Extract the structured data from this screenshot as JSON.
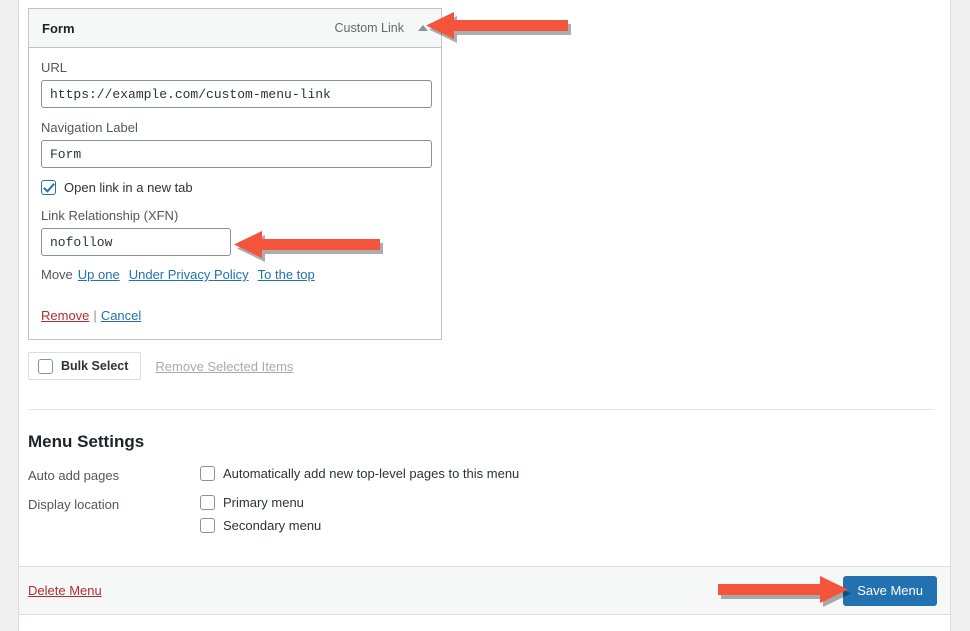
{
  "menu_item": {
    "title": "Form",
    "type_label": "Custom Link",
    "collapse_icon": "caret-up-icon",
    "fields": {
      "url_label": "URL",
      "url_value": "https://example.com/custom-menu-link",
      "url_placeholder": "https://",
      "nav_label_label": "Navigation Label",
      "nav_label_value": "Form",
      "nav_label_placeholder": "Navigation Label",
      "new_tab_label": "Open link in a new tab",
      "new_tab_checked": true,
      "xfn_label": "Link Relationship (XFN)",
      "xfn_value": "nofollow",
      "xfn_placeholder": "Link Relationship (XFN)"
    },
    "move": {
      "word": "Move",
      "links": [
        "Up one",
        "Under Privacy Policy",
        "To the top"
      ]
    },
    "actions": {
      "remove": "Remove",
      "separator": "|",
      "cancel": "Cancel"
    }
  },
  "bulk": {
    "select_label": "Bulk Select",
    "select_checked": false,
    "remove_selected_label": "Remove Selected Items",
    "remove_selected_disabled": true
  },
  "menu_settings": {
    "title": "Menu Settings",
    "auto_add": {
      "label": "Auto add pages",
      "option_label": "Automatically add new top-level pages to this menu",
      "checked": false
    },
    "display_location": {
      "label": "Display location",
      "options": [
        {
          "label": "Primary menu",
          "checked": false
        },
        {
          "label": "Secondary menu",
          "checked": false
        }
      ]
    }
  },
  "bottom_bar": {
    "delete_menu_label": "Delete Menu",
    "save_menu_label": "Save Menu"
  },
  "annotations": {
    "arrow_color": "#f4543c",
    "arrows": [
      {
        "name": "arrow-to-collapse-toggle",
        "direction": "left"
      },
      {
        "name": "arrow-to-xfn-field",
        "direction": "left"
      },
      {
        "name": "arrow-to-save-menu",
        "direction": "right"
      }
    ]
  },
  "colors": {
    "accent_blue": "#2271b1",
    "danger_red": "#b32d2e",
    "panel_border": "#c3c4c7",
    "page_bg": "#f0f0f1"
  }
}
